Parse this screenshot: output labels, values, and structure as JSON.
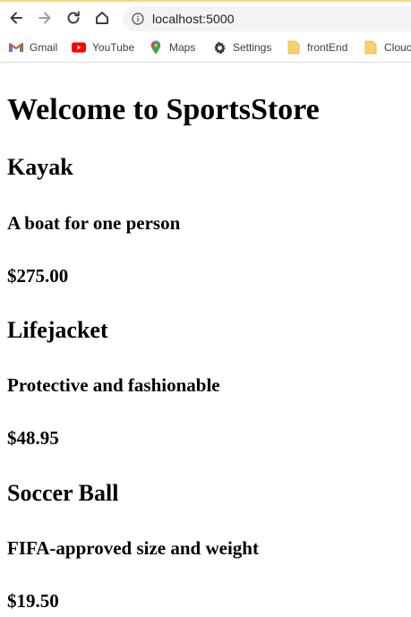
{
  "browser": {
    "url": "localhost:5000",
    "bookmarks": [
      {
        "label": "Gmail",
        "icon": "gmail-icon"
      },
      {
        "label": "YouTube",
        "icon": "youtube-icon"
      },
      {
        "label": "Maps",
        "icon": "maps-icon"
      },
      {
        "label": "Settings",
        "icon": "gear-icon"
      },
      {
        "label": "frontEnd",
        "icon": "folder-icon"
      },
      {
        "label": "Clouc",
        "icon": "folder-icon"
      }
    ]
  },
  "page": {
    "title": "Welcome to SportsStore",
    "products": [
      {
        "name": "Kayak",
        "description": "A boat for one person",
        "price": "$275.00"
      },
      {
        "name": "Lifejacket",
        "description": "Protective and fashionable",
        "price": "$48.95"
      },
      {
        "name": "Soccer Ball",
        "description": "FIFA-approved size and weight",
        "price": "$19.50"
      }
    ]
  },
  "colors": {
    "chrome_top_accent": "#f6d776",
    "omnibox_bg": "#f1f3f4",
    "folder": "#f9d26c",
    "youtube_red": "#ff0000"
  }
}
